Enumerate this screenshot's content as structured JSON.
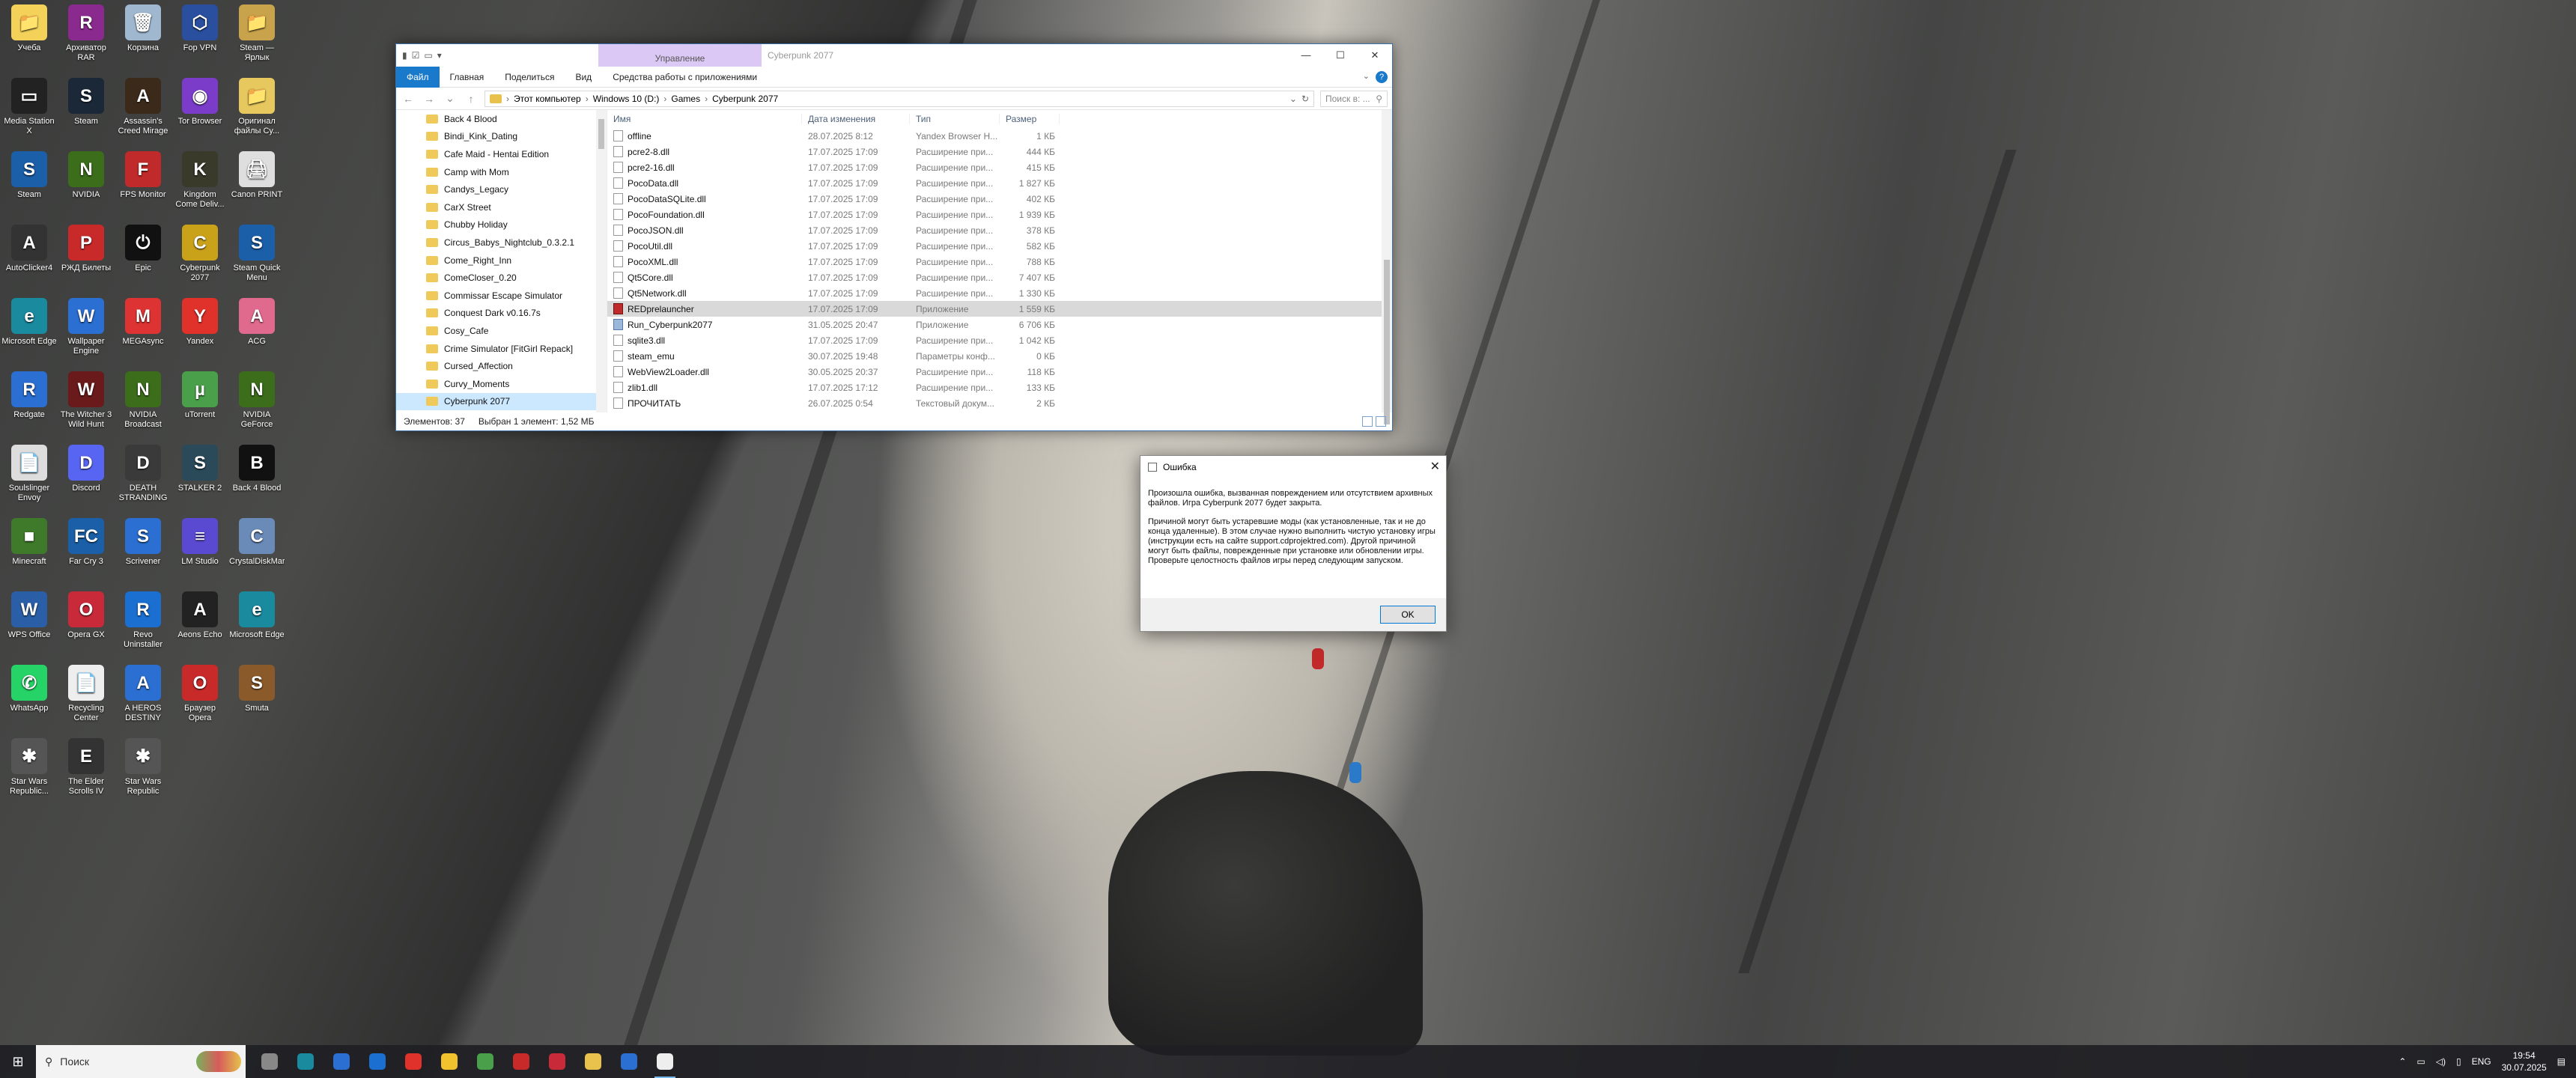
{
  "desktop": {
    "icons": [
      {
        "label": "Учеба",
        "color": "#f4d25a",
        "glyph": "📁"
      },
      {
        "label": "Архиватор RAR",
        "color": "#8b2a8e",
        "glyph": "R"
      },
      {
        "label": "Корзина",
        "color": "#9fb7cf",
        "glyph": "🗑"
      },
      {
        "label": "Fop VPN",
        "color": "#2a4f9e",
        "glyph": "⬡"
      },
      {
        "label": "Steam — Ярлык",
        "color": "#c9a34b",
        "glyph": "📁"
      },
      {
        "label": "Media Station X",
        "color": "#222",
        "glyph": "▭"
      },
      {
        "label": "Steam",
        "color": "#1b2838",
        "glyph": "S"
      },
      {
        "label": "Assassin's Creed Mirage",
        "color": "#3b2a1a",
        "glyph": "A"
      },
      {
        "label": "Tor Browser",
        "color": "#7a3cc9",
        "glyph": "◉"
      },
      {
        "label": "Оригинал файлы Cy...",
        "color": "#e6c85e",
        "glyph": "📁"
      },
      {
        "label": "Steam",
        "color": "#1b5fa8",
        "glyph": "S"
      },
      {
        "label": "NVIDIA",
        "color": "#3b6d1a",
        "glyph": "N"
      },
      {
        "label": "FPS Monitor",
        "color": "#c02a2a",
        "glyph": "F"
      },
      {
        "label": "Kingdom Come Deliv...",
        "color": "#3a3a2a",
        "glyph": "K"
      },
      {
        "label": "Canon PRINT",
        "color": "#dedede",
        "glyph": "🖨"
      },
      {
        "label": "AutoClicker4",
        "color": "#333",
        "glyph": "A"
      },
      {
        "label": "РЖД Билеты",
        "color": "#c82a2a",
        "glyph": "Р"
      },
      {
        "label": "Epic",
        "color": "#111",
        "glyph": "⏻"
      },
      {
        "label": "Cyberpunk 2077",
        "color": "#caa21a",
        "glyph": "C"
      },
      {
        "label": "Steam Quick Menu",
        "color": "#1b5fa8",
        "glyph": "S"
      },
      {
        "label": "Microsoft Edge",
        "color": "#1a8a9e",
        "glyph": "e"
      },
      {
        "label": "Wallpaper Engine",
        "color": "#2a6fd1",
        "glyph": "W"
      },
      {
        "label": "MEGAsync",
        "color": "#d33",
        "glyph": "M"
      },
      {
        "label": "Yandex",
        "color": "#e0312a",
        "glyph": "Y"
      },
      {
        "label": "ACG",
        "color": "#e06a8e",
        "glyph": "A"
      },
      {
        "label": "Redgate",
        "color": "#2a6fd1",
        "glyph": "R"
      },
      {
        "label": "The Witcher 3 Wild Hunt",
        "color": "#6a1a1a",
        "glyph": "W"
      },
      {
        "label": "NVIDIA Broadcast",
        "color": "#3b6d1a",
        "glyph": "N"
      },
      {
        "label": "uTorrent",
        "color": "#4aa04a",
        "glyph": "µ"
      },
      {
        "label": "NVIDIA GeForce",
        "color": "#3b6d1a",
        "glyph": "N"
      },
      {
        "label": "Soulslinger Envoy",
        "color": "#ddd",
        "glyph": "📄"
      },
      {
        "label": "Discord",
        "color": "#5865f2",
        "glyph": "D"
      },
      {
        "label": "DEATH STRANDING",
        "color": "#3a3a3a",
        "glyph": "D"
      },
      {
        "label": "STALKER 2",
        "color": "#2a4a5a",
        "glyph": "S"
      },
      {
        "label": "Back 4 Blood",
        "color": "#111",
        "glyph": "B"
      },
      {
        "label": "Minecraft",
        "color": "#3e7a2a",
        "glyph": "■"
      },
      {
        "label": "Far Cry 3",
        "color": "#1a5fa8",
        "glyph": "FC"
      },
      {
        "label": "Scrivener",
        "color": "#2a6fd1",
        "glyph": "S"
      },
      {
        "label": "LM Studio",
        "color": "#5a4ad1",
        "glyph": "≡"
      },
      {
        "label": "CrystalDiskMark",
        "color": "#6a8ab8",
        "glyph": "C"
      },
      {
        "label": "WPS Office",
        "color": "#2a5fa8",
        "glyph": "W"
      },
      {
        "label": "Opera GX",
        "color": "#c82a3a",
        "glyph": "O"
      },
      {
        "label": "Revo Uninstaller",
        "color": "#1a6fd1",
        "glyph": "R"
      },
      {
        "label": "Aeons Echo",
        "color": "#222",
        "glyph": "A"
      },
      {
        "label": "Microsoft Edge",
        "color": "#1a8a9e",
        "glyph": "e"
      },
      {
        "label": "WhatsApp",
        "color": "#25d366",
        "glyph": "✆"
      },
      {
        "label": "Recycling Center",
        "color": "#eee",
        "glyph": "📄"
      },
      {
        "label": "A HEROS DESTINY",
        "color": "#2a6fd1",
        "glyph": "A"
      },
      {
        "label": "Браузер Opera",
        "color": "#c82a2a",
        "glyph": "O"
      },
      {
        "label": "Smuta",
        "color": "#8a5a2a",
        "glyph": "S"
      },
      {
        "label": "Star Wars Republic...",
        "color": "#555",
        "glyph": "✱"
      },
      {
        "label": "The Elder Scrolls IV",
        "color": "#333",
        "glyph": "E"
      },
      {
        "label": "Star Wars Republic",
        "color": "#555",
        "glyph": "✱"
      }
    ]
  },
  "explorer": {
    "manage_tab": "Управление",
    "title": "Cyberpunk 2077",
    "controls": {
      "minimize": "—",
      "maximize": "☐",
      "close": "✕"
    },
    "ribbon_tabs": [
      "Файл",
      "Главная",
      "Поделиться",
      "Вид",
      "Средства работы с приложениями"
    ],
    "help": "?",
    "breadcrumb": [
      "Этот компьютер",
      "Windows 10 (D:)",
      "Games",
      "Cyberpunk 2077"
    ],
    "search_placeholder": "Поиск в: ...",
    "tree": [
      "Back 4 Blood",
      "Bindi_Kink_Dating",
      "Cafe Maid - Hentai Edition",
      "Camp with Mom",
      "Candys_Legacy",
      "CarX Street",
      "Chubby Holiday",
      "Circus_Babys_Nightclub_0.3.2.1",
      "Come_Right_Inn",
      "ComeCloser_0.20",
      "Commissar Escape Simulator",
      "Conquest Dark v0.16.7s",
      "Cosy_Cafe",
      "Crime Simulator [FitGirl Repack]",
      "Cursed_Affection",
      "Curvy_Moments",
      "Cyberpunk 2077"
    ],
    "tree_selected_index": 16,
    "columns": [
      "Имя",
      "Дата изменения",
      "Тип",
      "Размер"
    ],
    "files": [
      {
        "name": "offline",
        "date": "28.07.2025 8:12",
        "type": "Yandex Browser H...",
        "size": "1 КБ",
        "icon": "doc"
      },
      {
        "name": "pcre2-8.dll",
        "date": "17.07.2025 17:09",
        "type": "Расширение при...",
        "size": "444 КБ",
        "icon": "doc"
      },
      {
        "name": "pcre2-16.dll",
        "date": "17.07.2025 17:09",
        "type": "Расширение при...",
        "size": "415 КБ",
        "icon": "doc"
      },
      {
        "name": "PocoData.dll",
        "date": "17.07.2025 17:09",
        "type": "Расширение при...",
        "size": "1 827 КБ",
        "icon": "doc"
      },
      {
        "name": "PocoDataSQLite.dll",
        "date": "17.07.2025 17:09",
        "type": "Расширение при...",
        "size": "402 КБ",
        "icon": "doc"
      },
      {
        "name": "PocoFoundation.dll",
        "date": "17.07.2025 17:09",
        "type": "Расширение при...",
        "size": "1 939 КБ",
        "icon": "doc"
      },
      {
        "name": "PocoJSON.dll",
        "date": "17.07.2025 17:09",
        "type": "Расширение при...",
        "size": "378 КБ",
        "icon": "doc"
      },
      {
        "name": "PocoUtil.dll",
        "date": "17.07.2025 17:09",
        "type": "Расширение при...",
        "size": "582 КБ",
        "icon": "doc"
      },
      {
        "name": "PocoXML.dll",
        "date": "17.07.2025 17:09",
        "type": "Расширение при...",
        "size": "788 КБ",
        "icon": "doc"
      },
      {
        "name": "Qt5Core.dll",
        "date": "17.07.2025 17:09",
        "type": "Расширение при...",
        "size": "7 407 КБ",
        "icon": "doc"
      },
      {
        "name": "Qt5Network.dll",
        "date": "17.07.2025 17:09",
        "type": "Расширение при...",
        "size": "1 330 КБ",
        "icon": "doc"
      },
      {
        "name": "REDprelauncher",
        "date": "17.07.2025 17:09",
        "type": "Приложение",
        "size": "1 559 КБ",
        "icon": "app"
      },
      {
        "name": "Run_Cyberpunk2077",
        "date": "31.05.2025 20:47",
        "type": "Приложение",
        "size": "6 706 КБ",
        "icon": "exe"
      },
      {
        "name": "sqlite3.dll",
        "date": "17.07.2025 17:09",
        "type": "Расширение при...",
        "size": "1 042 КБ",
        "icon": "doc"
      },
      {
        "name": "steam_emu",
        "date": "30.07.2025 19:48",
        "type": "Параметры конф...",
        "size": "0 КБ",
        "icon": "doc"
      },
      {
        "name": "WebView2Loader.dll",
        "date": "30.05.2025 20:37",
        "type": "Расширение при...",
        "size": "118 КБ",
        "icon": "doc"
      },
      {
        "name": "zlib1.dll",
        "date": "17.07.2025 17:12",
        "type": "Расширение при...",
        "size": "133 КБ",
        "icon": "doc"
      },
      {
        "name": "ПРОЧИТАТЬ",
        "date": "26.07.2025 0:54",
        "type": "Текстовый докум...",
        "size": "2 КБ",
        "icon": "doc"
      }
    ],
    "selected_file_index": 11,
    "status": {
      "count": "Элементов: 37",
      "selection": "Выбран 1 элемент: 1,52 МБ"
    }
  },
  "dialog": {
    "title": "Ошибка",
    "close": "✕",
    "paragraph1": "Произошла ошибка, вызванная повреждением или отсутствием архивных файлов. Игра Cyberpunk 2077 будет закрыта.",
    "paragraph2": "Причиной могут быть устаревшие моды (как установленные, так и не до конца удаленные). В этом случае нужно выполнить чистую установку игры (инструкции есть на сайте support.cdprojektred.com). Другой причиной могут быть файлы, поврежденные при установке или обновлении игры. Проверьте целостность файлов игры перед следующим запуском.",
    "ok_label": "OK"
  },
  "taskbar": {
    "start": "⊞",
    "search_label": "Поиск",
    "apps": [
      {
        "name": "task-view",
        "color": "#888"
      },
      {
        "name": "edge",
        "color": "#1a8a9e"
      },
      {
        "name": "store",
        "color": "#2a6fd1"
      },
      {
        "name": "outlook",
        "color": "#1a6fd1"
      },
      {
        "name": "yandex",
        "color": "#e0312a"
      },
      {
        "name": "beeline",
        "color": "#f2c12e"
      },
      {
        "name": "uget",
        "color": "#4aa04a"
      },
      {
        "name": "opera",
        "color": "#c82a2a"
      },
      {
        "name": "opera-gx",
        "color": "#c82a3a"
      },
      {
        "name": "explorer",
        "color": "#e9c14d"
      },
      {
        "name": "shield",
        "color": "#2a6fd1"
      },
      {
        "name": "document",
        "color": "#eee"
      }
    ],
    "active_app_index": 11,
    "lang": "ENG",
    "time": "19:54",
    "date": "30.07.2025"
  }
}
